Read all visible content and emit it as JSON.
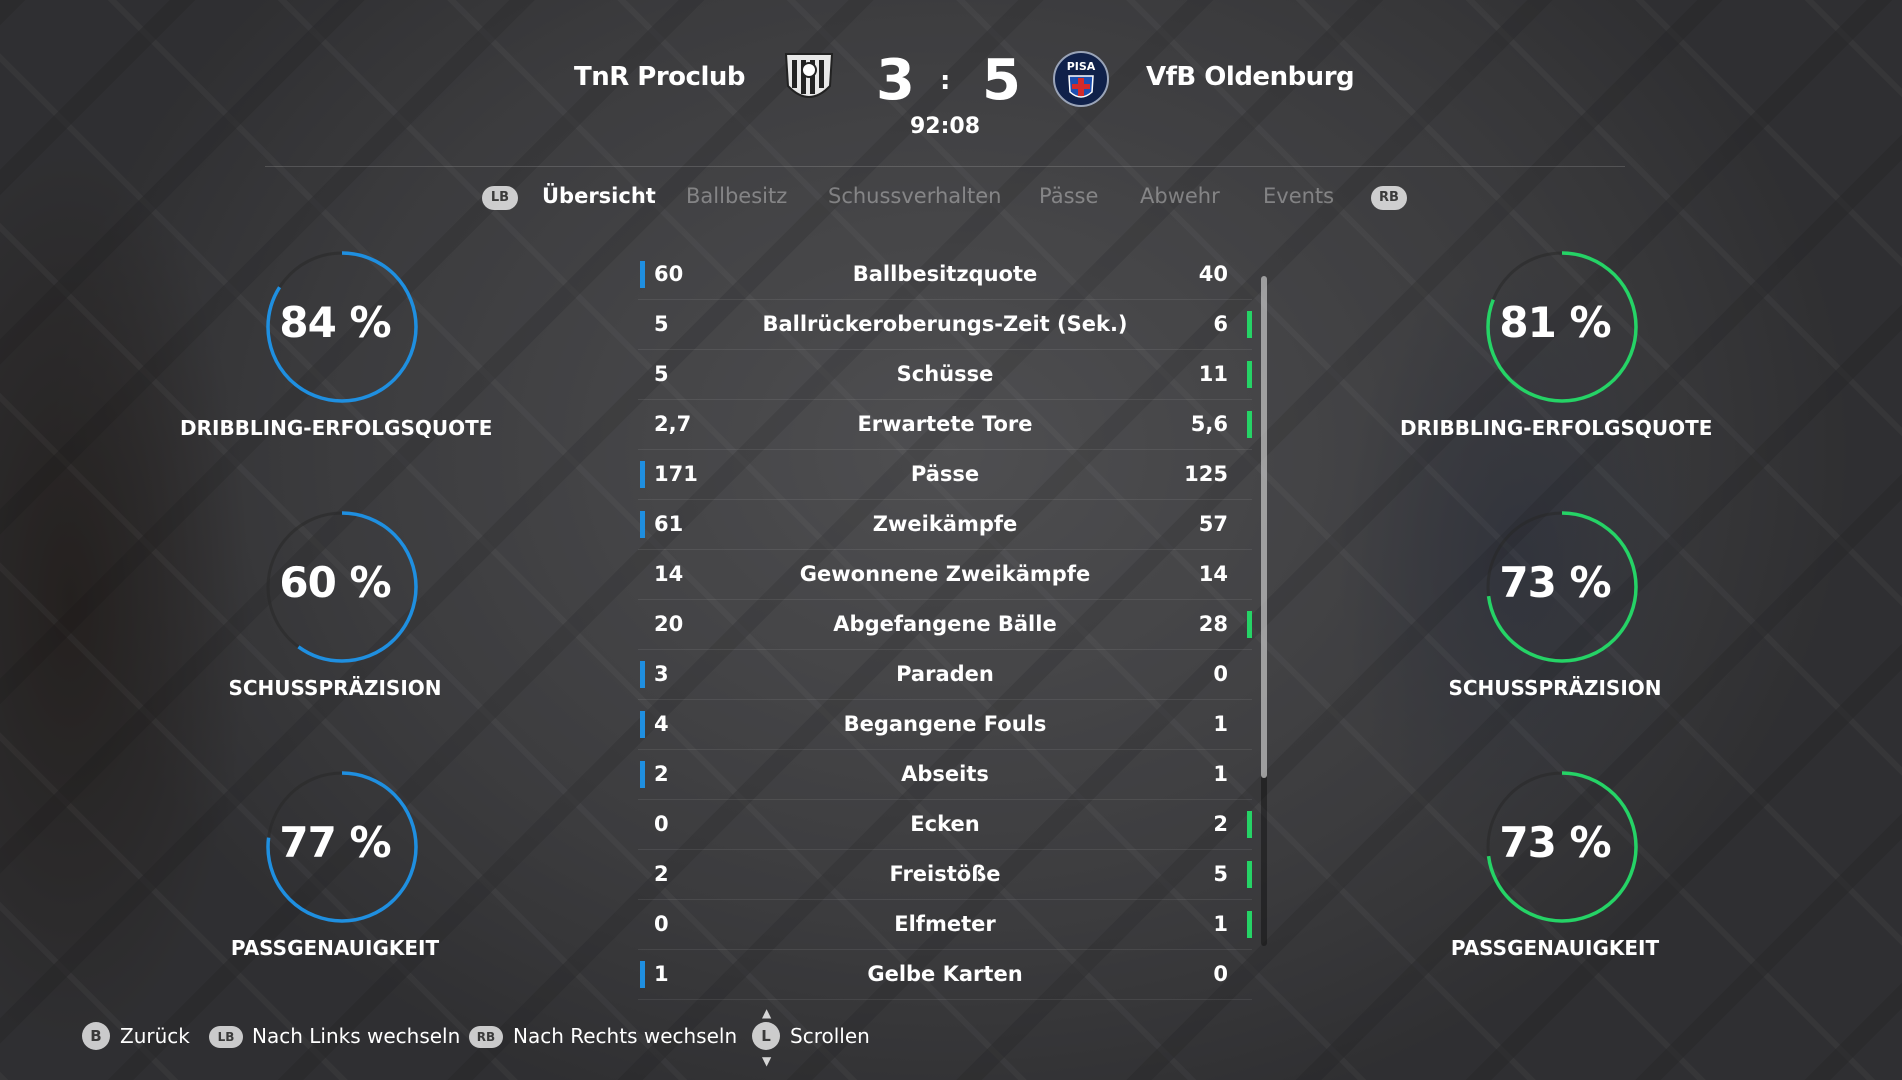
{
  "match": {
    "home_team": "TnR Proclub",
    "away_team": "VfB Oldenburg",
    "home_score": "3",
    "away_score": "5",
    "separator": ":",
    "clock": "92:08",
    "away_crest_text": "PISA"
  },
  "tabs": {
    "lb": "LB",
    "rb": "RB",
    "items": [
      "Übersicht",
      "Ballbesitz",
      "Schussverhalten",
      "Pässe",
      "Abwehr",
      "Events"
    ],
    "active_index": 0
  },
  "gauges": {
    "home": [
      {
        "value": "84 %",
        "fraction": 0.84,
        "label": "DRIBBLING-ERFOLGSQUOTE"
      },
      {
        "value": "60 %",
        "fraction": 0.6,
        "label": "SCHUSSPRÄZISION"
      },
      {
        "value": "77 %",
        "fraction": 0.77,
        "label": "PASSGENAUIGKEIT"
      }
    ],
    "away": [
      {
        "value": "81 %",
        "fraction": 0.81,
        "label": "DRIBBLING-ERFOLGSQUOTE"
      },
      {
        "value": "73 %",
        "fraction": 0.73,
        "label": "SCHUSSPRÄZISION"
      },
      {
        "value": "73 %",
        "fraction": 0.73,
        "label": "PASSGENAUIGKEIT"
      }
    ]
  },
  "stats": [
    {
      "name": "Ballbesitzquote",
      "home": "60",
      "away": "40",
      "leader": "home"
    },
    {
      "name": "Ballrückeroberungs-Zeit (Sek.)",
      "home": "5",
      "away": "6",
      "leader": "away"
    },
    {
      "name": "Schüsse",
      "home": "5",
      "away": "11",
      "leader": "away"
    },
    {
      "name": "Erwartete Tore",
      "home": "2,7",
      "away": "5,6",
      "leader": "away"
    },
    {
      "name": "Pässe",
      "home": "171",
      "away": "125",
      "leader": "home"
    },
    {
      "name": "Zweikämpfe",
      "home": "61",
      "away": "57",
      "leader": "home"
    },
    {
      "name": "Gewonnene Zweikämpfe",
      "home": "14",
      "away": "14",
      "leader": "none"
    },
    {
      "name": "Abgefangene Bälle",
      "home": "20",
      "away": "28",
      "leader": "away"
    },
    {
      "name": "Paraden",
      "home": "3",
      "away": "0",
      "leader": "home"
    },
    {
      "name": "Begangene Fouls",
      "home": "4",
      "away": "1",
      "leader": "home"
    },
    {
      "name": "Abseits",
      "home": "2",
      "away": "1",
      "leader": "home"
    },
    {
      "name": "Ecken",
      "home": "0",
      "away": "2",
      "leader": "away"
    },
    {
      "name": "Freistöße",
      "home": "2",
      "away": "5",
      "leader": "away"
    },
    {
      "name": "Elfmeter",
      "home": "0",
      "away": "1",
      "leader": "away"
    },
    {
      "name": "Gelbe Karten",
      "home": "1",
      "away": "0",
      "leader": "home"
    }
  ],
  "footer": {
    "back_key": "B",
    "back_label": "Zurück",
    "left_key": "LB",
    "left_label": "Nach Links wechseln",
    "right_key": "RB",
    "right_label": "Nach Rechts wechseln",
    "scroll_key": "L",
    "scroll_label": "Scrollen"
  },
  "colors": {
    "home_accent": "#1f8fe0",
    "away_accent": "#25d366"
  }
}
